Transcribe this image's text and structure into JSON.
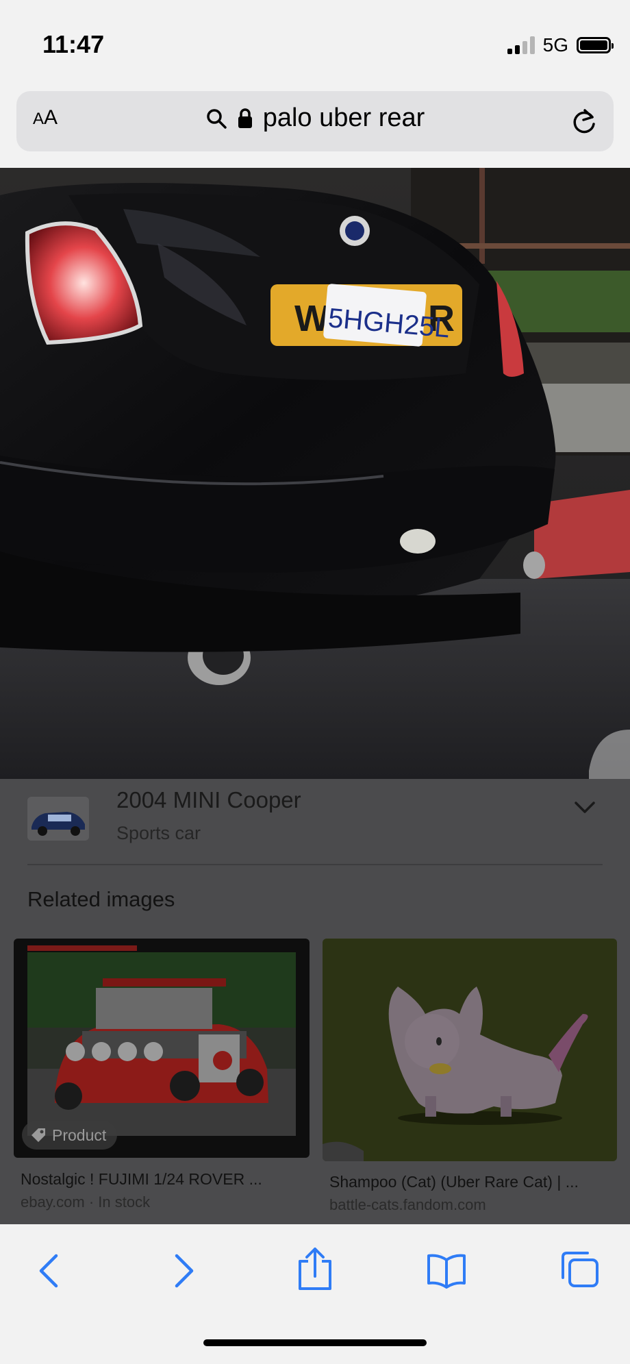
{
  "status_bar": {
    "time": "11:47",
    "network": "5G"
  },
  "address_bar": {
    "text_size_label_small": "A",
    "text_size_label_large": "A",
    "url_text": "palo uber rear"
  },
  "hero_image": {
    "plate_text": "5HGH25L",
    "plate_left_char": "W",
    "plate_right_char": "R"
  },
  "entity": {
    "title": "2004 MINI Cooper",
    "subtitle": "Sports car"
  },
  "related": {
    "heading": "Related images",
    "cards": [
      {
        "title": "Nostalgic ! FUJIMI 1/24 ROVER ...",
        "source": "ebay.com · In stock",
        "badge": "Product"
      },
      {
        "title": "Shampoo (Cat) (Uber Rare Cat) | ...",
        "source": "battle-cats.fandom.com"
      }
    ]
  },
  "colors": {
    "accent": "#2f7cf6",
    "overlay": "#4b4b4d",
    "bar_background": "#f2f2f2"
  },
  "icons": {
    "search": "search-icon",
    "lock": "lock-icon",
    "reload": "reload-icon",
    "chevron": "chevron-down-icon",
    "back": "back-icon",
    "forward": "forward-icon",
    "share": "share-icon",
    "bookmarks": "bookmarks-icon",
    "tabs": "tabs-icon"
  }
}
